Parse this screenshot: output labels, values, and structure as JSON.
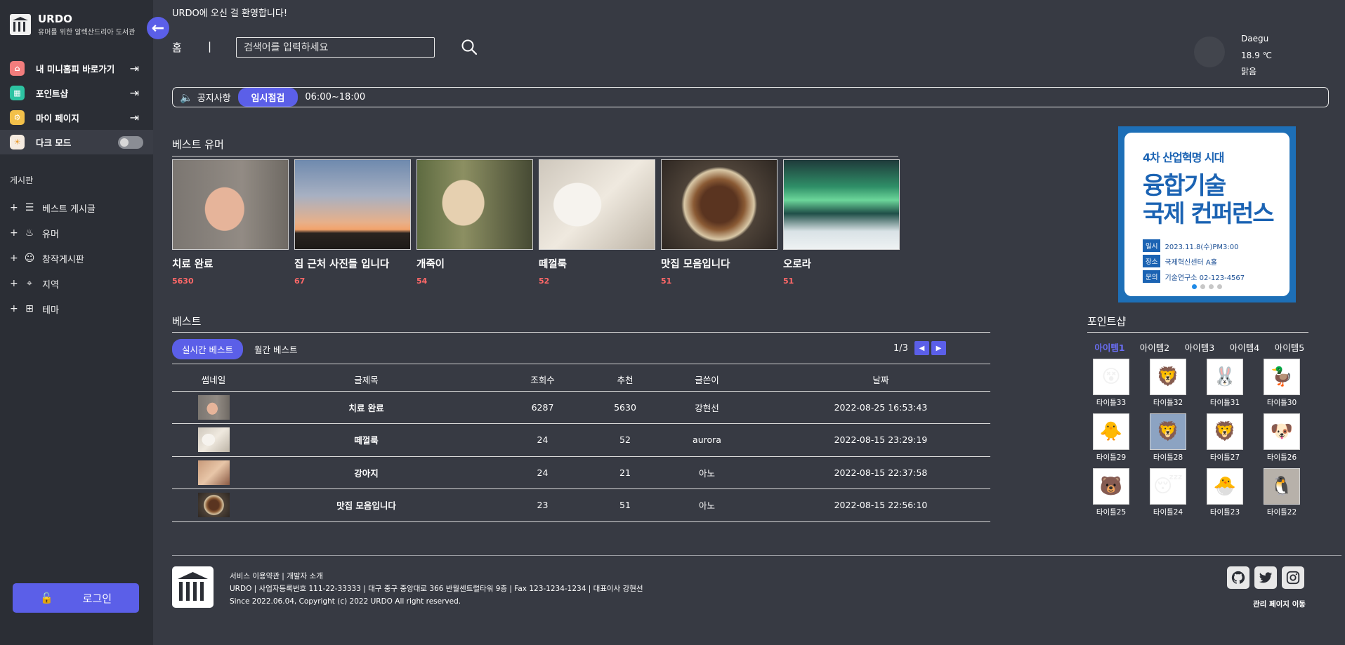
{
  "brand": {
    "title": "URDO",
    "subtitle": "유머를 위한 알렉산드리아 도서관"
  },
  "sidebar": {
    "items": [
      {
        "label": "내 미니홈피 바로가기",
        "icon": "home-icon"
      },
      {
        "label": "포인트샵",
        "icon": "shop-icon"
      },
      {
        "label": "마이 페이지",
        "icon": "settings-icon"
      },
      {
        "label": "다크 모드",
        "icon": "sun-icon"
      }
    ],
    "board_label": "게시판",
    "boards": [
      {
        "label": "베스트 게시글",
        "icon": "list-icon"
      },
      {
        "label": "유머",
        "icon": "flame-icon"
      },
      {
        "label": "창작게시판",
        "icon": "mask-icon"
      },
      {
        "label": "지역",
        "icon": "pin-icon"
      },
      {
        "label": "테마",
        "icon": "grid-icon"
      }
    ],
    "login_label": "로그인"
  },
  "header": {
    "welcome": "URDO에 오신 걸 환영합니다!",
    "home": "홈",
    "separator": "|",
    "search_placeholder": "검색어를 입력하세요"
  },
  "weather": {
    "city": "Daegu",
    "temp": "18.9 ℃",
    "condition": "맑음"
  },
  "notice": {
    "label": "공지사항",
    "badge": "임시점검",
    "time": "06:00~18:00"
  },
  "best_users": {
    "title": "베스트 유머",
    "cards": [
      {
        "name": "치료 완료",
        "likes": "5630"
      },
      {
        "name": "집 근처 사진들 입니다",
        "likes": "67"
      },
      {
        "name": "개죽이",
        "likes": "54"
      },
      {
        "name": "떼껄룩",
        "likes": "52"
      },
      {
        "name": "맛집 모음입니다",
        "likes": "51"
      },
      {
        "name": "오로라",
        "likes": "51"
      }
    ]
  },
  "best": {
    "title": "베스트",
    "tab_realtime": "실시간 베스트",
    "tab_monthly": "월간 베스트",
    "page": "1/3",
    "prev": "◀",
    "next": "▶",
    "headers": [
      "썸네일",
      "글제목",
      "조회수",
      "추천",
      "글쓴이",
      "날짜"
    ],
    "rows": [
      {
        "title": "치료 완료",
        "views": "6287",
        "likes": "5630",
        "author": "강현선",
        "date": "2022-08-25 16:53:43"
      },
      {
        "title": "떼껄룩",
        "views": "24",
        "likes": "52",
        "author": "aurora",
        "date": "2022-08-15 23:29:19"
      },
      {
        "title": "강아지",
        "views": "24",
        "likes": "21",
        "author": "아노",
        "date": "2022-08-15 22:37:58"
      },
      {
        "title": "맛집 모음입니다",
        "views": "23",
        "likes": "51",
        "author": "아노",
        "date": "2022-08-15 22:56:10"
      }
    ]
  },
  "banner": {
    "subtitle": "4차 산업혁명 시대",
    "title_line1": "융합기술",
    "title_line2": "국제 컨퍼런스",
    "rows": [
      {
        "tag": "일시",
        "value": "2023.11.8(수)PM3:00"
      },
      {
        "tag": "장소",
        "value": "국제혁신센터 A홀"
      },
      {
        "tag": "문의",
        "value": "기술연구소 02-123-4567"
      }
    ]
  },
  "point_shop": {
    "title": "포인트샵",
    "tabs": [
      "아이템1",
      "아이템2",
      "아이템3",
      "아이템4",
      "아이템5"
    ],
    "items": [
      "타이틀33",
      "타이틀32",
      "타이틀31",
      "타이틀30",
      "타이틀29",
      "타이틀28",
      "타이틀27",
      "타이틀26",
      "타이틀25",
      "타이틀24",
      "타이틀23",
      "타이틀22"
    ]
  },
  "footer": {
    "links": "서비스 이용약관 | 개발자 소개",
    "info": "URDO | 사업자등록번호 111-22-33333 | 대구 중구 중앙대로 366 반월센트럴타워 9층 | Fax 123-1234-1234 | 대표이사 강현선",
    "copyright": "Since 2022.06.04, Copyright (c) 2022 URDO All right reserved.",
    "admin": "관리 페이지 이동",
    "socials": [
      "github-icon",
      "twitter-icon",
      "instagram-icon"
    ]
  },
  "colors": {
    "accent": "#5b5fe8",
    "likes": "#ff6868",
    "background": "#373a43",
    "sidebar": "#2b2e35"
  }
}
